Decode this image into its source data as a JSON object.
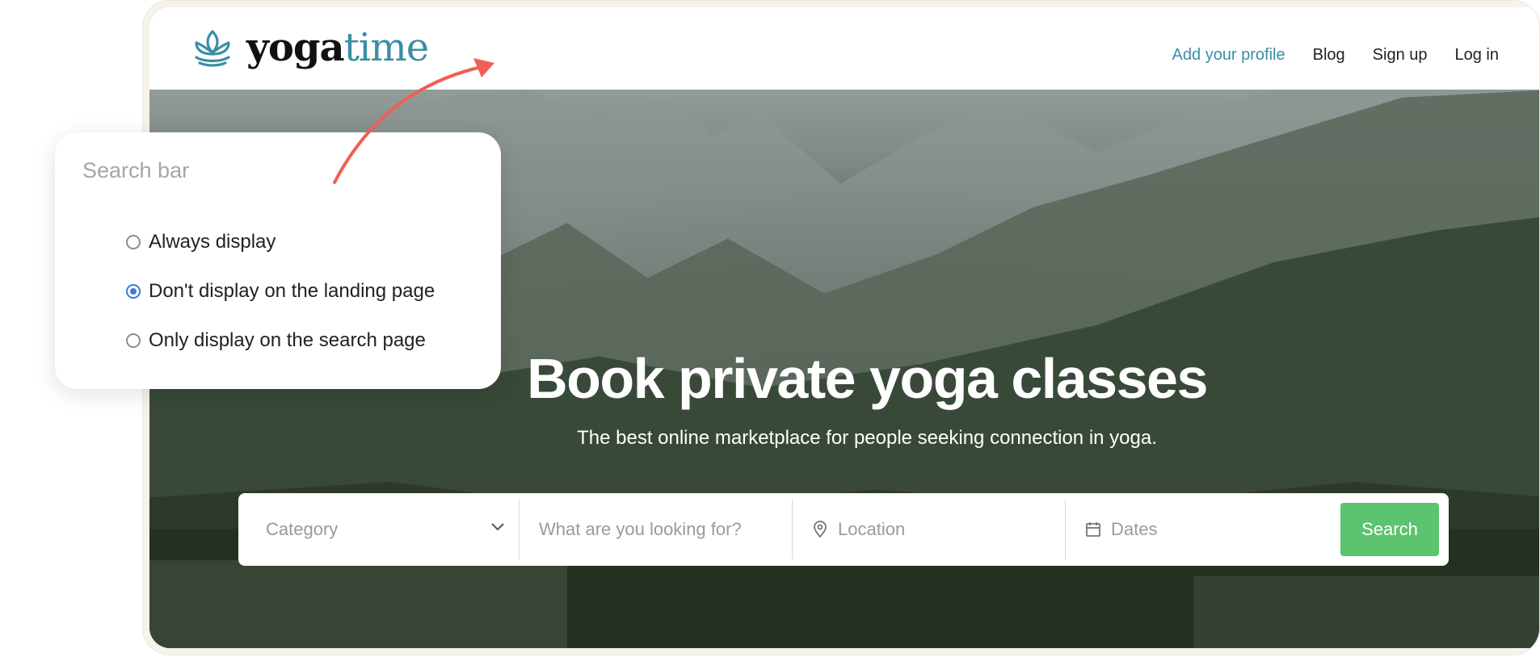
{
  "site": {
    "logo": {
      "part1": "yoga",
      "part2": "time",
      "accent_color": "#3a8ea6"
    },
    "nav": [
      {
        "label": "Add your profile"
      },
      {
        "label": "Blog"
      },
      {
        "label": "Sign up"
      },
      {
        "label": "Log in"
      }
    ],
    "hero": {
      "title": "Book private yoga classes",
      "subtitle": "The best online marketplace for people seeking connection in yoga."
    },
    "search": {
      "category_placeholder": "Category",
      "query_placeholder": "What are you looking for?",
      "location_placeholder": "Location",
      "dates_placeholder": "Dates",
      "button_label": "Search",
      "button_color": "#5cc36e"
    }
  },
  "settings_panel": {
    "title": "Search bar",
    "options": [
      {
        "label": "Always display",
        "selected": false
      },
      {
        "label": "Don't display on the landing page",
        "selected": true
      },
      {
        "label": "Only display on the search page",
        "selected": false
      }
    ],
    "radio_color": "#3c7bd6"
  },
  "annotation": {
    "arrow_color": "#ef5f55",
    "arrow_icon": "curved-arrow-icon"
  }
}
